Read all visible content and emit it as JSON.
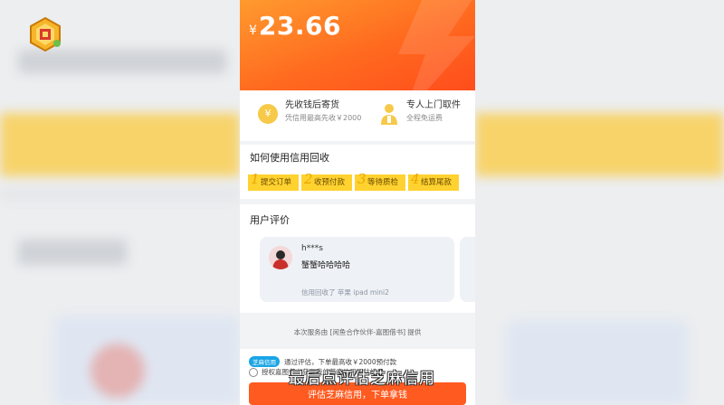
{
  "hero": {
    "currency": "¥",
    "amount": "23.66"
  },
  "features": [
    {
      "icon": "yen-coin-icon",
      "coin_char": "¥",
      "title": "先收钱后寄货",
      "desc": "凭信用最高先收￥2000"
    },
    {
      "icon": "courier-icon",
      "title": "专人上门取件",
      "desc": "全程免运费"
    }
  ],
  "how": {
    "title": "如何使用信用回收",
    "steps": [
      {
        "n": "1",
        "label": "提交订单"
      },
      {
        "n": "2",
        "label": "收预付款"
      },
      {
        "n": "3",
        "label": "等待质检"
      },
      {
        "n": "4",
        "label": "结算尾款"
      }
    ]
  },
  "reviews": {
    "title": "用户评价",
    "items": [
      {
        "user": "h***s",
        "comment": "蟹蟹哈哈哈哈",
        "device": "信用回收了 苹果 ipad mini2"
      }
    ]
  },
  "provider_text": "本次服务由 [闲鱼合作伙伴-嘉图借书] 提供",
  "bottom": {
    "badge": "芝麻信用",
    "row1_text": "通过评估，下单最高收￥2000预付款",
    "row2_text": "授权嘉图借书获取我的芝麻信用评估结果",
    "cta": "评估芝麻信用，下单拿钱"
  },
  "subtitle": "最后点评估芝麻信用",
  "colors": {
    "accent": "#ff5a1f",
    "step_yellow": "#ffd230",
    "badge_blue": "#1aa5e5"
  }
}
